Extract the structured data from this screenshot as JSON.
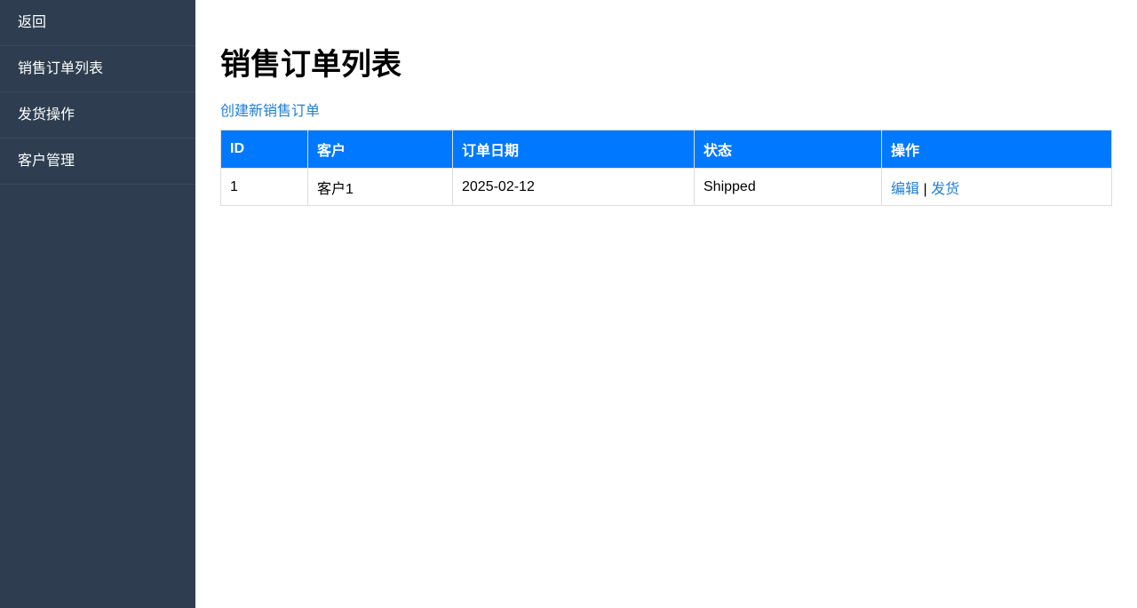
{
  "sidebar": {
    "items": [
      {
        "label": "返回"
      },
      {
        "label": "销售订单列表"
      },
      {
        "label": "发货操作"
      },
      {
        "label": "客户管理"
      }
    ]
  },
  "main": {
    "title": "销售订单列表",
    "create_link": "创建新销售订单",
    "table": {
      "headers": [
        "ID",
        "客户",
        "订单日期",
        "状态",
        "操作"
      ],
      "rows": [
        {
          "id": "1",
          "customer": "客户1",
          "date": "2025-02-12",
          "status": "Shipped",
          "actions": {
            "edit": "编辑",
            "separator": "|",
            "ship": "发货"
          }
        }
      ]
    }
  },
  "colors": {
    "sidebar_bg": "#2e3e50",
    "header_bg": "#0078ff",
    "link": "#1f7fd8"
  }
}
